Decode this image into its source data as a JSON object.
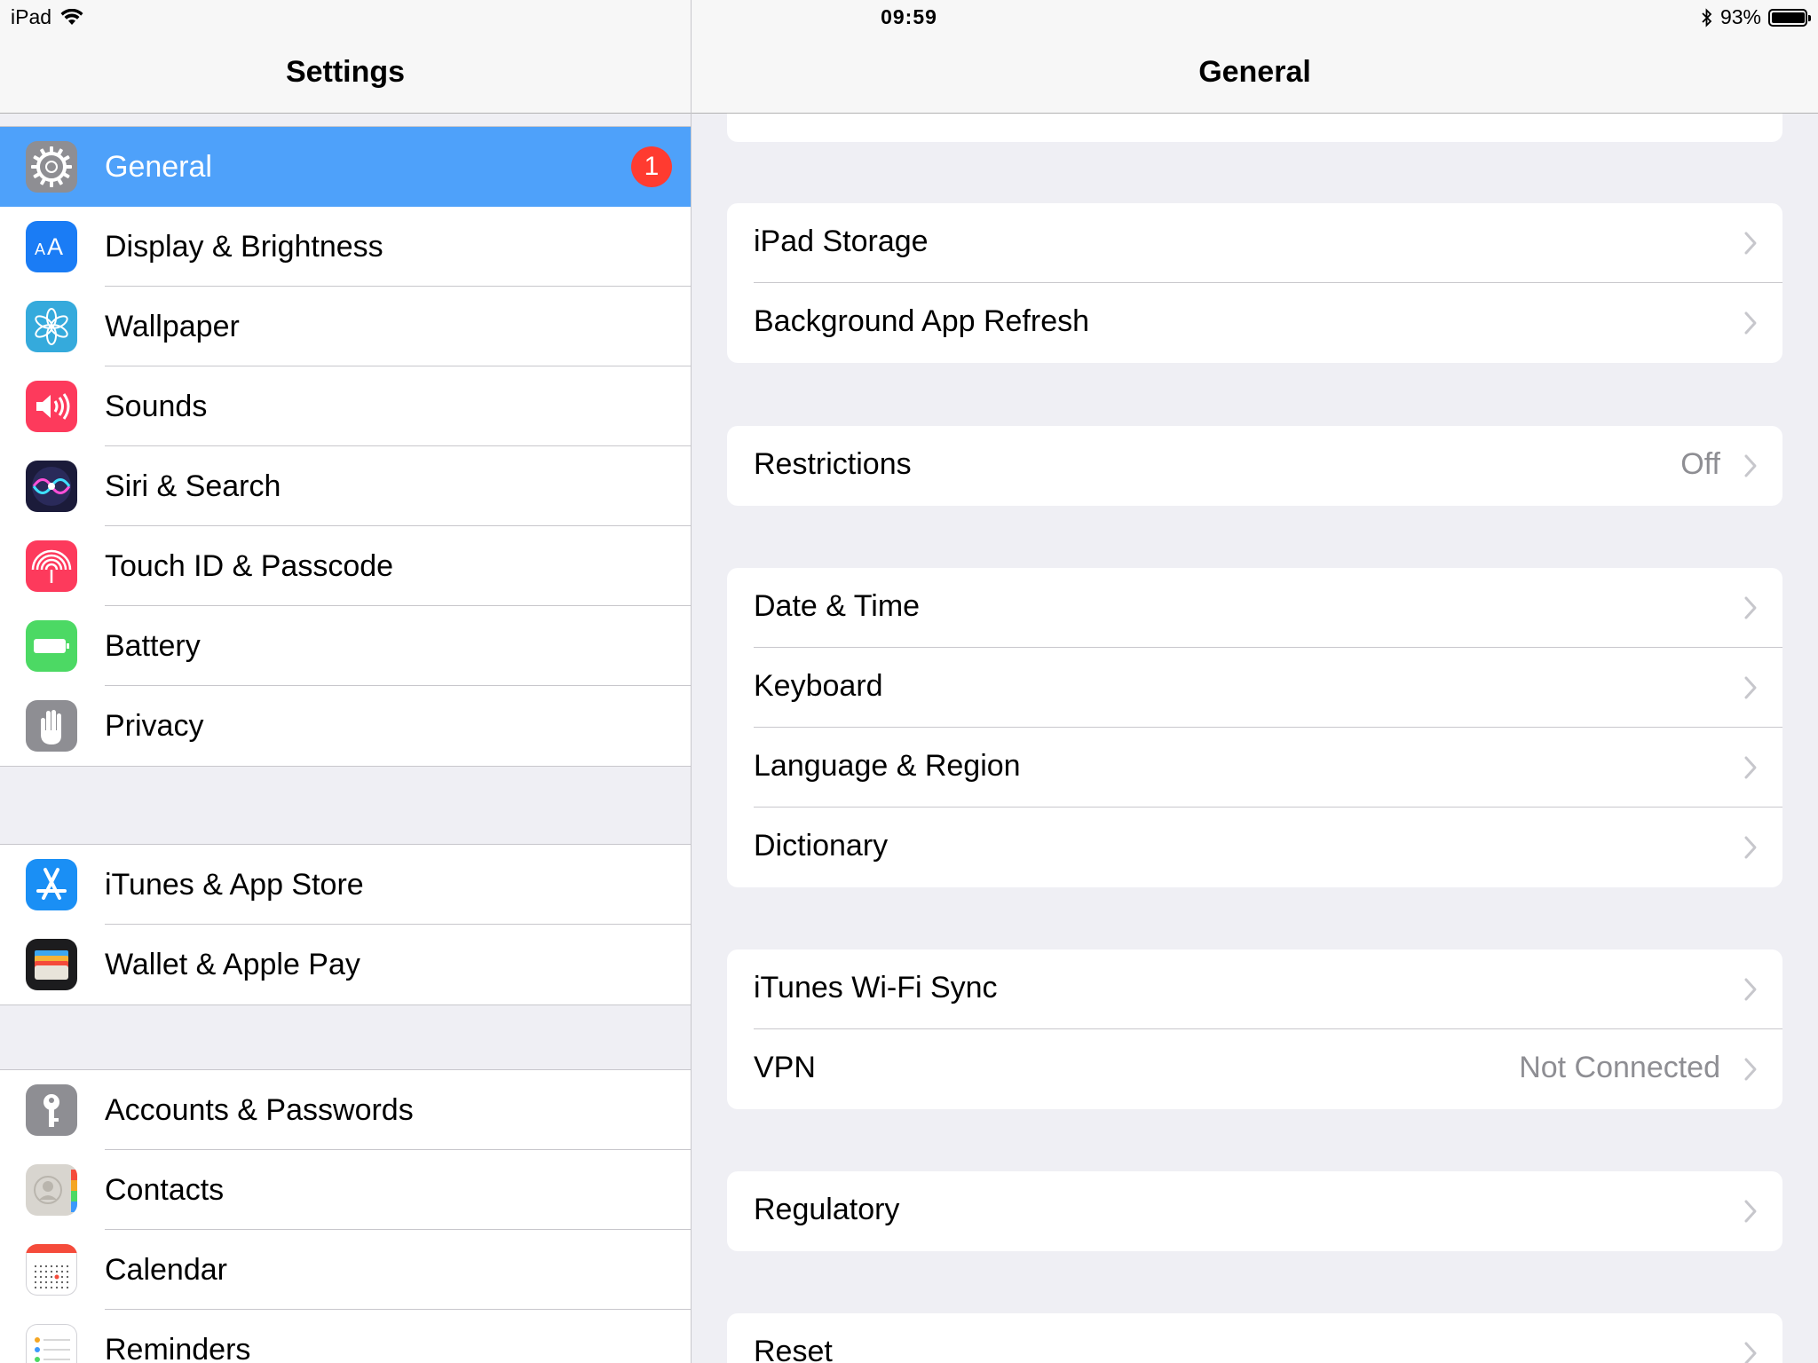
{
  "status": {
    "device": "iPad",
    "time": "09:59",
    "battery": "93%",
    "battery_level": 0.93
  },
  "master": {
    "title": "Settings",
    "groups": [
      [
        {
          "label": "General",
          "icon": "gear-icon",
          "color": "#8e8e93",
          "badge": "1",
          "selected": true
        },
        {
          "label": "Display & Brightness",
          "icon": "text-size-icon",
          "color": "#1a7cf5"
        },
        {
          "label": "Wallpaper",
          "icon": "flower-icon",
          "color": "#35aadc"
        },
        {
          "label": "Sounds",
          "icon": "speaker-icon",
          "color": "#fd3a5c"
        },
        {
          "label": "Siri & Search",
          "icon": "siri-icon",
          "color": "#1b1b3a"
        },
        {
          "label": "Touch ID & Passcode",
          "icon": "fingerprint-icon",
          "color": "#fd3a5c"
        },
        {
          "label": "Battery",
          "icon": "battery-icon",
          "color": "#4cd964"
        },
        {
          "label": "Privacy",
          "icon": "hand-icon",
          "color": "#8e8e93"
        }
      ],
      [
        {
          "label": "iTunes & App Store",
          "icon": "app-store-icon",
          "color": "#1a8ff5"
        },
        {
          "label": "Wallet & Apple Pay",
          "icon": "wallet-icon",
          "color": "#1c1c1e"
        }
      ],
      [
        {
          "label": "Accounts & Passwords",
          "icon": "key-icon",
          "color": "#8e8e93"
        },
        {
          "label": "Contacts",
          "icon": "contacts-icon",
          "color": "#d8d5cf"
        },
        {
          "label": "Calendar",
          "icon": "calendar-icon",
          "color": "#ffffff"
        },
        {
          "label": "Reminders",
          "icon": "reminders-icon",
          "color": "#ffffff"
        }
      ]
    ]
  },
  "detail": {
    "title": "General",
    "groups": [
      [
        {
          "label": "iPad Storage",
          "value": ""
        },
        {
          "label": "Background App Refresh",
          "value": ""
        }
      ],
      [
        {
          "label": "Restrictions",
          "value": "Off"
        }
      ],
      [
        {
          "label": "Date & Time",
          "value": ""
        },
        {
          "label": "Keyboard",
          "value": ""
        },
        {
          "label": "Language & Region",
          "value": ""
        },
        {
          "label": "Dictionary",
          "value": ""
        }
      ],
      [
        {
          "label": "iTunes Wi-Fi Sync",
          "value": ""
        },
        {
          "label": "VPN",
          "value": "Not Connected"
        }
      ],
      [
        {
          "label": "Regulatory",
          "value": ""
        }
      ],
      [
        {
          "label": "Reset",
          "value": ""
        }
      ]
    ]
  },
  "colors": {
    "selection": "#4ea1fa",
    "badge": "#ff3b30",
    "background": "#efeff4",
    "secondary_text": "#8e8e93"
  }
}
